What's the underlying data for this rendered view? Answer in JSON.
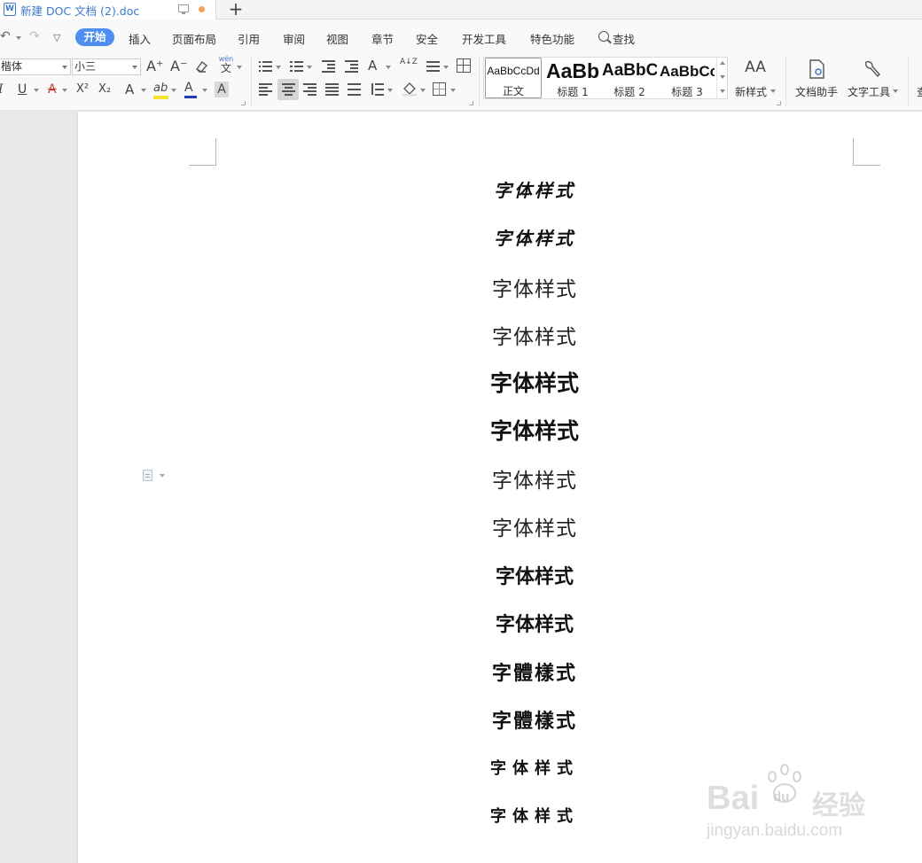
{
  "titlebar": {
    "doc_icon_letter": "W",
    "doc_title": "新建 DOC 文档 (2).doc",
    "new_tab_symbol": "+"
  },
  "menu": {
    "undo_symbol": "↶",
    "redo_symbol": "↷",
    "more_symbol": "▽",
    "active_tab": "开始",
    "tabs": [
      "插入",
      "页面布局",
      "引用",
      "审阅",
      "视图",
      "章节",
      "安全",
      "开发工具",
      "特色功能"
    ],
    "search_label": "查找"
  },
  "ribbon": {
    "font_name": "楷体",
    "font_size": "小三",
    "grow_font": "A⁺",
    "shrink_font": "A⁻",
    "pinyin_top": "wén",
    "pinyin_char": "文",
    "italic": "I",
    "underline": "U",
    "strike": "A",
    "superscript": "X²",
    "subscript": "X₂",
    "text_effect": "A",
    "highlight": "ab",
    "font_color": "A",
    "char_shade": "A",
    "highlight_color": "#f5e22b",
    "font_color_bar": "#1f3fbf",
    "sort_icon": "A↓Z",
    "gallery": [
      {
        "sample": "AaBbCcDd",
        "label": "正文"
      },
      {
        "sample": "AaBb",
        "label": "标题 1"
      },
      {
        "sample": "AaBbC",
        "label": "标题 2"
      },
      {
        "sample": "AaBbCc",
        "label": "标题 3"
      }
    ],
    "new_style": "新样式",
    "new_style_icon": "AA",
    "doc_helper": "文档助手",
    "text_tools": "文字工具",
    "cut_off": "查"
  },
  "document": {
    "lines": [
      {
        "text": "字体样式",
        "style": "cal"
      },
      {
        "text": "字体样式",
        "style": "cal"
      },
      {
        "text": "字体样式",
        "style": "song"
      },
      {
        "text": "字体样式",
        "style": "song"
      },
      {
        "text": "字体样式",
        "style": "hei"
      },
      {
        "text": "字体样式",
        "style": "hei"
      },
      {
        "text": "字体样式",
        "style": "song"
      },
      {
        "text": "字体样式",
        "style": "song"
      },
      {
        "text": "字体样式",
        "style": "mix"
      },
      {
        "text": "字体样式",
        "style": "mix"
      },
      {
        "text": "字體樣式",
        "style": "trad"
      },
      {
        "text": "字體樣式",
        "style": "trad"
      },
      {
        "text": "字体样式",
        "style": "wide"
      },
      {
        "text": "字体样式",
        "style": "wide"
      }
    ]
  },
  "watermark": {
    "brand": "Bai",
    "brand_du": "du",
    "brand_cn": "经验",
    "url": "jingyan.baidu.com"
  }
}
